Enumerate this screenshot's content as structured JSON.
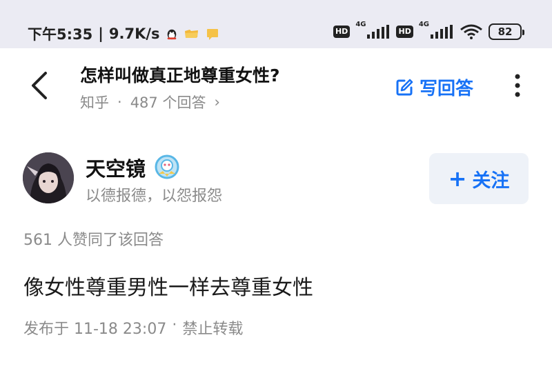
{
  "status_bar": {
    "time": "下午5:35",
    "speed": "9.7K/s",
    "hd_label": "HD",
    "net_label": "4G",
    "battery": "82",
    "icons": [
      "qq-icon",
      "folder-icon",
      "message-icon",
      "signal-icon",
      "wifi-icon",
      "battery-icon"
    ]
  },
  "header": {
    "title": "怎样叫做真正地尊重女性?",
    "source": "知乎",
    "separator": "·",
    "answer_count": "487 个回答",
    "chevron": "›",
    "write_label": "写回答"
  },
  "author": {
    "name": "天空镜",
    "bio": "以德报德，以怨报怨",
    "follow_label": "关注",
    "follow_plus": "+"
  },
  "answer": {
    "likes": "561 人赞同了该回答",
    "content": "像女性尊重男性一样去尊重女性",
    "published": "发布于 11-18 23:07",
    "dot": "·",
    "copyright": "禁止转载"
  },
  "colors": {
    "status_bg": "#ebebf3",
    "accent": "#1772f6",
    "muted": "#8a8a8a",
    "follow_bg": "#eef2f8"
  }
}
